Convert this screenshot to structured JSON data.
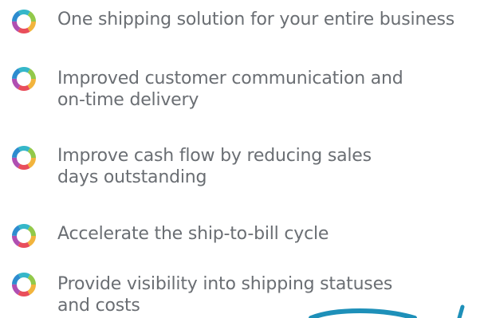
{
  "benefits": [
    {
      "icon": "multicolor-ring-icon",
      "text": "One shipping solution for your entire business"
    },
    {
      "icon": "multicolor-ring-icon",
      "text": "Improved customer communication and\non-time delivery"
    },
    {
      "icon": "multicolor-ring-icon",
      "text": "Improve cash flow by reducing sales\ndays outstanding"
    },
    {
      "icon": "multicolor-ring-icon",
      "text": "Accelerate the ship-to-bill cycle"
    },
    {
      "icon": "multicolor-ring-icon",
      "text": "Provide visibility into shipping statuses\nand costs"
    }
  ],
  "colors": {
    "text": "#6a6e73",
    "ring": [
      "#f2b43d",
      "#e94e5b",
      "#b04fb2",
      "#2d8ccf",
      "#35b7c9",
      "#92c94a"
    ],
    "decoration": "#1e90b9"
  }
}
